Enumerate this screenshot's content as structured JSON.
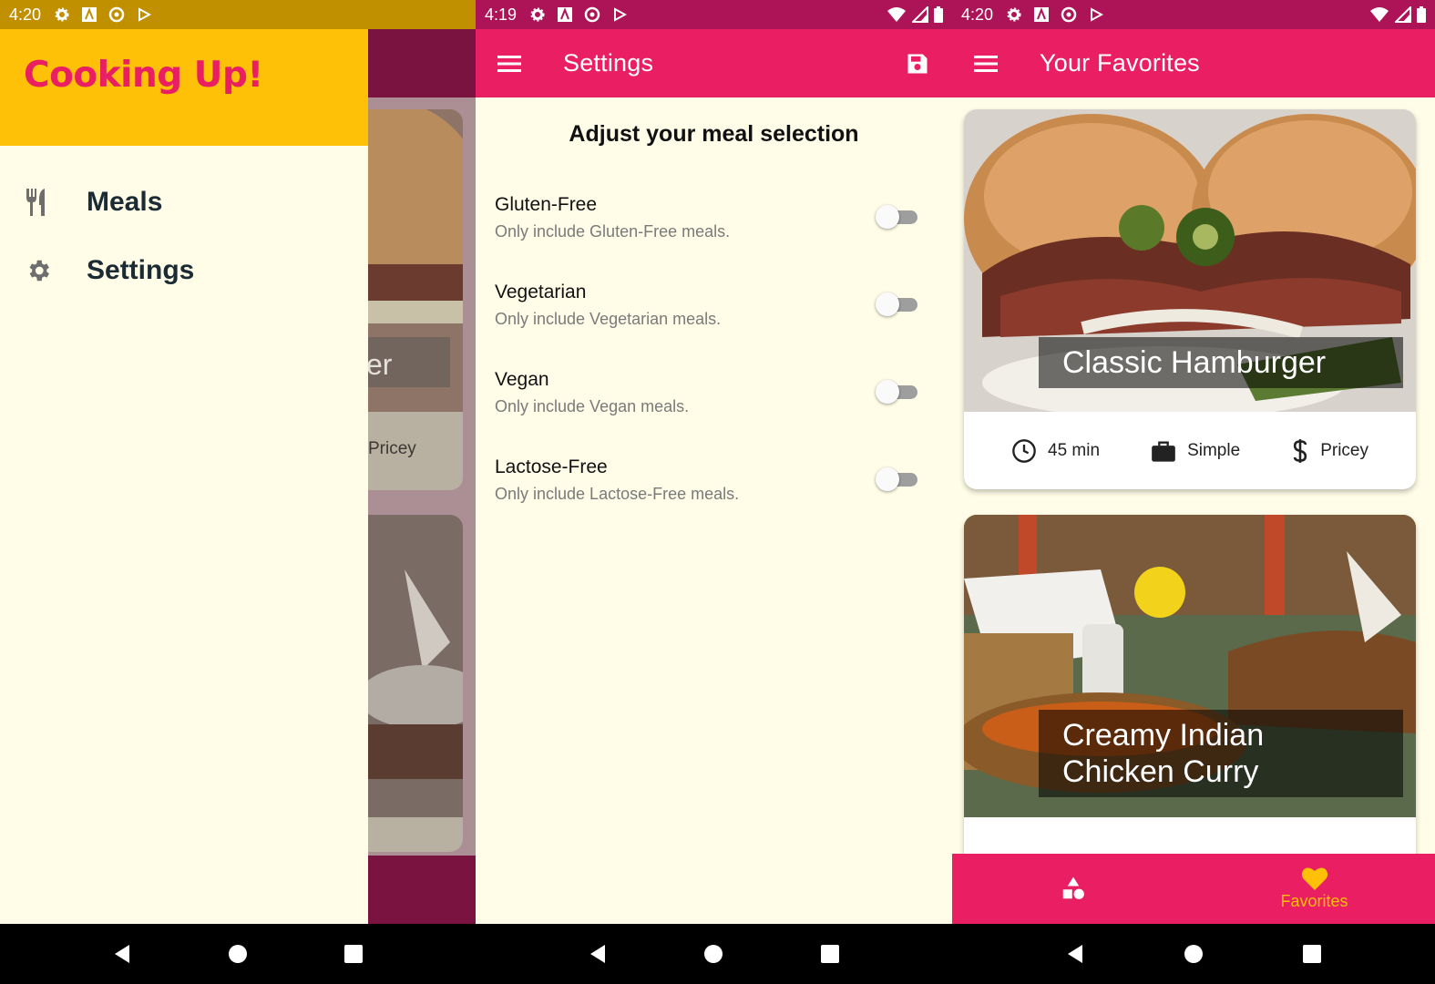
{
  "screens": {
    "drawer": {
      "status_time": "4:20",
      "title": "Cooking Up!",
      "items": [
        {
          "label": "Meals",
          "icon": "restaurant-icon"
        },
        {
          "label": "Settings",
          "icon": "gear-icon"
        }
      ],
      "background_card_fragments": [
        "er",
        "Pricey"
      ]
    },
    "settings": {
      "status_time": "4:19",
      "appbar_title": "Settings",
      "heading": "Adjust your meal selection",
      "filters": [
        {
          "title": "Gluten-Free",
          "subtitle": "Only include Gluten-Free meals.",
          "enabled": false
        },
        {
          "title": "Vegetarian",
          "subtitle": "Only include Vegetarian meals.",
          "enabled": false
        },
        {
          "title": "Vegan",
          "subtitle": "Only include Vegan meals.",
          "enabled": false
        },
        {
          "title": "Lactose-Free",
          "subtitle": "Only include Lactose-Free meals.",
          "enabled": false
        }
      ]
    },
    "favorites": {
      "status_time": "4:20",
      "appbar_title": "Your Favorites",
      "meals": [
        {
          "title": "Classic Hamburger",
          "duration": "45 min",
          "complexity": "Simple",
          "affordability": "Pricey"
        },
        {
          "title": "Creamy Indian Chicken Curry",
          "duration": "",
          "complexity": "",
          "affordability": ""
        }
      ],
      "tabs": [
        {
          "label": "",
          "icon": "category-icon",
          "selected": false
        },
        {
          "label": "Favorites",
          "icon": "heart-icon",
          "selected": true
        }
      ]
    }
  },
  "colors": {
    "primary": "#e91e63",
    "accent": "#ffc107",
    "canvas": "#fffde7",
    "status_dark": "#ad1457",
    "drawer_status": "#c09000"
  }
}
